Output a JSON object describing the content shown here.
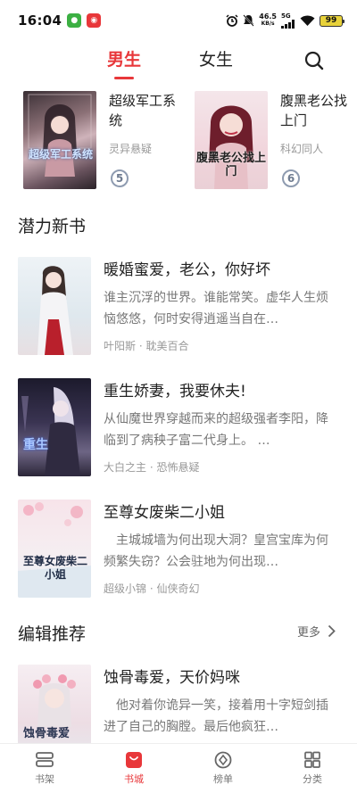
{
  "status_bar": {
    "time": "16:04",
    "net_speed_value": "46.5",
    "net_speed_unit": "KB/s",
    "network_type": "5G",
    "battery": "99"
  },
  "tabs": [
    {
      "label": "男生",
      "active": true
    },
    {
      "label": "女生",
      "active": false
    }
  ],
  "top_books": [
    {
      "title": "超级军工系统",
      "category": "灵异悬疑",
      "rank": "5",
      "cover_text": "超级军工系统"
    },
    {
      "title": "腹黑老公找上门",
      "category": "科幻同人",
      "rank": "6",
      "cover_text": "腹黑老公找上门"
    }
  ],
  "sections": {
    "potential": {
      "title": "潜力新书"
    },
    "editor": {
      "title": "编辑推荐",
      "more": "更多"
    }
  },
  "potential_books": [
    {
      "title": "暖婚蜜爱，老公，你好坏",
      "desc": "谁主沉浮的世界。谁能常笑。虚华人生烦恼悠悠，何时安得逍遥当自在…",
      "author": "叶阳斯",
      "category": "耽美百合"
    },
    {
      "title": "重生娇妻，我要休夫!",
      "desc": "从仙魔世界穿越而来的超级强者李阳，降临到了病秧子富二代身上。 …",
      "author": "大白之主",
      "category": "恐怖悬疑"
    },
    {
      "title": "至尊女废柴二小姐",
      "desc": "　主城城墙为何出现大洞？皇宫宝库为何频繁失窃？公会驻地为何出现…",
      "author": "超级小锦",
      "category": "仙侠奇幻"
    }
  ],
  "editor_books": [
    {
      "title": "蚀骨毒爱，天价妈咪",
      "desc": "　他对着你诡异一笑，接着用十字短剑插进了自己的胸膛。最后他疯狂…"
    }
  ],
  "bottom_nav": [
    {
      "label": "书架",
      "icon": "bookshelf-icon",
      "active": false
    },
    {
      "label": "书城",
      "icon": "bookstore-icon",
      "active": true
    },
    {
      "label": "榜单",
      "icon": "ranking-icon",
      "active": false
    },
    {
      "label": "分类",
      "icon": "category-icon",
      "active": false
    }
  ],
  "colors": {
    "accent": "#e8373a",
    "text_primary": "#222222",
    "text_secondary": "#777777",
    "text_meta": "#999999"
  }
}
